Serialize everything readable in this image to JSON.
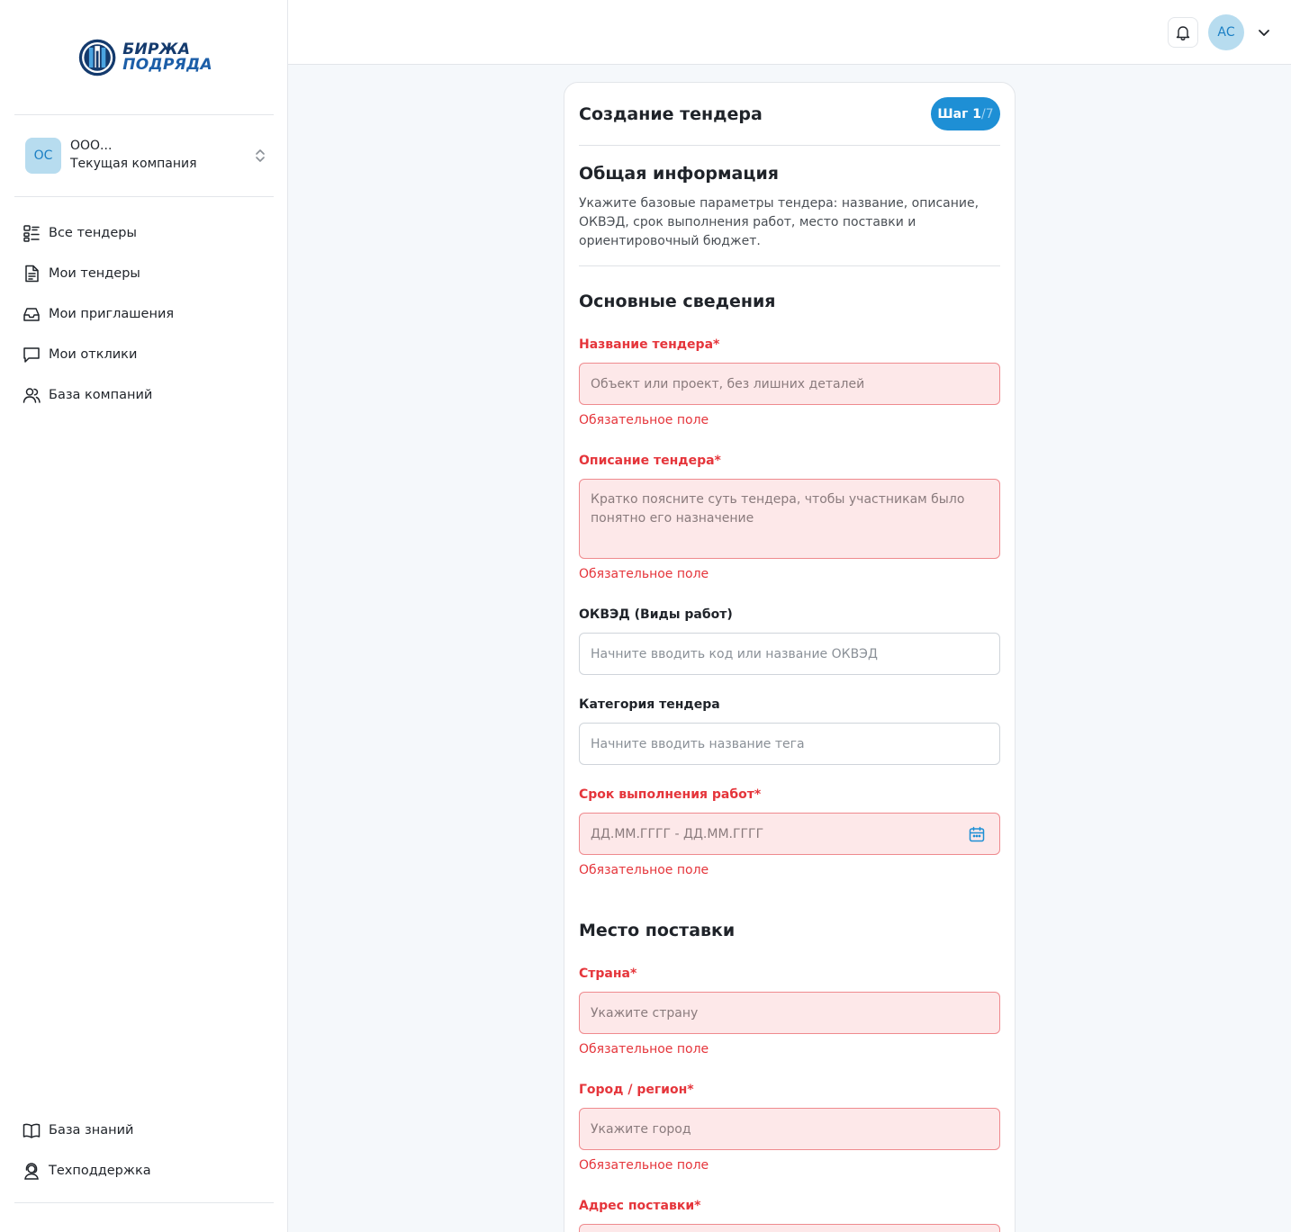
{
  "brand": {
    "line1": "БИРЖА",
    "line2": "ПОДРЯДА"
  },
  "company": {
    "initials": "ОС",
    "name": "ООО...",
    "subtitle": "Текущая компания"
  },
  "nav": {
    "items": [
      {
        "label": "Все тендеры",
        "icon": "list-icon"
      },
      {
        "label": "Мои тендеры",
        "icon": "document-icon"
      },
      {
        "label": "Мои приглашения",
        "icon": "inbox-icon"
      },
      {
        "label": "Мои отклики",
        "icon": "chat-icon"
      },
      {
        "label": "База компаний",
        "icon": "users-icon"
      }
    ],
    "bottom": [
      {
        "label": "База знаний",
        "icon": "book-icon"
      },
      {
        "label": "Техподдержка",
        "icon": "support-icon"
      }
    ]
  },
  "header": {
    "user_initials": "АС"
  },
  "card": {
    "title": "Создание тендера",
    "step_label": "Шаг 1",
    "step_total": "/7",
    "section_title": "Общая информация",
    "section_desc": "Укажите базовые параметры тендера: название, описание, ОКВЭД, срок выполнения работ, место поставки и ориентировочный бюджет.",
    "basic_title": "Основные сведения",
    "delivery_title": "Место поставки"
  },
  "fields": {
    "name": {
      "label": "Название тендера*",
      "placeholder": "Объект или проект, без лишних деталей",
      "error": "Обязательное поле"
    },
    "description": {
      "label": "Описание тендера*",
      "placeholder": "Кратко поясните суть тендера, чтобы участникам было понятно его назначение",
      "error": "Обязательное поле"
    },
    "okved": {
      "label": "ОКВЭД (Виды работ)",
      "placeholder": "Начните вводить код или название ОКВЭД"
    },
    "category": {
      "label": "Категория тендера",
      "placeholder": "Начните вводить название тега"
    },
    "deadline": {
      "label": "Срок выполнения работ*",
      "placeholder": "ДД.ММ.ГГГГ - ДД.ММ.ГГГГ",
      "error": "Обязательное поле"
    },
    "country": {
      "label": "Страна*",
      "placeholder": "Укажите страну",
      "error": "Обязательное поле"
    },
    "city": {
      "label": "Город / регион*",
      "placeholder": "Укажите город",
      "error": "Обязательное поле"
    },
    "address": {
      "label": "Адрес поставки*"
    }
  },
  "colors": {
    "accent": "#1e8fd5",
    "error": "#e5353b",
    "error_bg": "#fde8e9",
    "avatar_bg": "#b7dcef"
  }
}
